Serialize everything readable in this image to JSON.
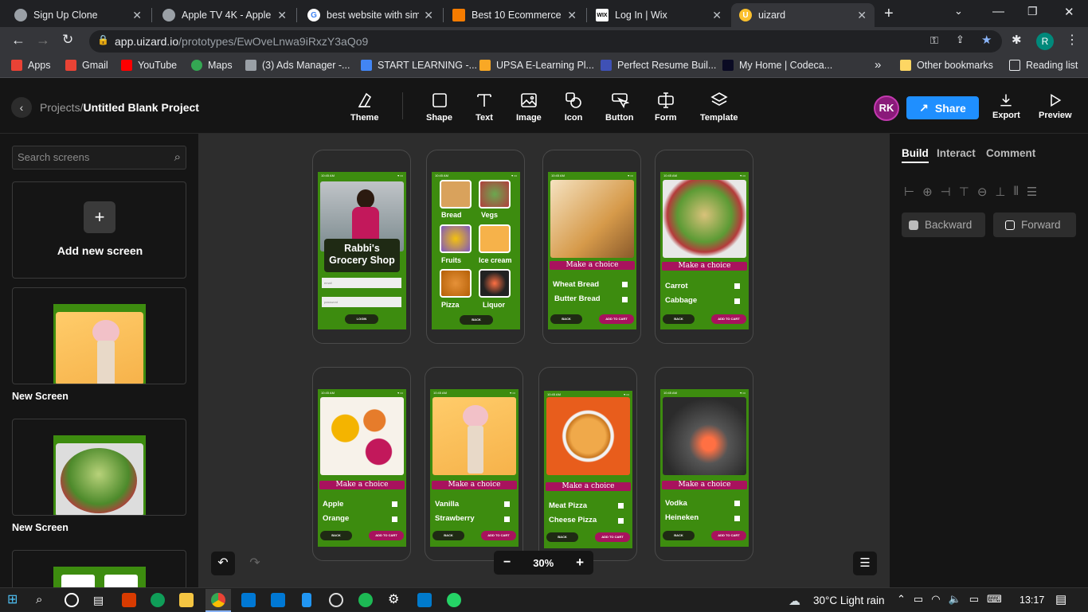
{
  "browser": {
    "tabs": [
      {
        "title": "Sign Up Clone",
        "color": "#9aa0a6"
      },
      {
        "title": "Apple TV 4K - Apple",
        "color": "#9aa0a6"
      },
      {
        "title": "best website with simp",
        "color": "#4285f4"
      },
      {
        "title": "Best 10 Ecommerce S",
        "color": "#f57c00"
      },
      {
        "title": "Log In | Wix",
        "color": "#ffffff"
      },
      {
        "title": "uizard",
        "color": "#fbc02d"
      }
    ],
    "new_tab": "+",
    "url_host": "app.uizard.io",
    "url_path": "/prototypes/EwOveLnwa9iRxzY3aQo9",
    "profile_initial": "R",
    "bookmarks": [
      {
        "label": "Apps",
        "color": "#e94235"
      },
      {
        "label": "Gmail",
        "color": "#ea4335"
      },
      {
        "label": "YouTube",
        "color": "#ff0000"
      },
      {
        "label": "Maps",
        "color": "#34a853"
      },
      {
        "label": "(3) Ads Manager -...",
        "color": "#9aa0a6"
      },
      {
        "label": "START LEARNING -...",
        "color": "#4285f4"
      },
      {
        "label": "UPSA E-Learning Pl...",
        "color": "#f9a825"
      },
      {
        "label": "Perfect Resume Buil...",
        "color": "#3f51b5"
      },
      {
        "label": "My Home | Codeca...",
        "color": "#0a0a23"
      }
    ],
    "more": "»",
    "other_bookmarks": "Other bookmarks",
    "reading_list": "Reading list"
  },
  "app": {
    "breadcrumb_root": "Projects",
    "breadcrumb_sep": "/",
    "project_title": "Untitled Blank Project",
    "tools": [
      {
        "label": "Theme",
        "icon": "theme-icon"
      },
      {
        "label": "Shape",
        "icon": "shape-icon"
      },
      {
        "label": "Text",
        "icon": "text-icon"
      },
      {
        "label": "Image",
        "icon": "image-icon"
      },
      {
        "label": "Icon",
        "icon": "icon-icon"
      },
      {
        "label": "Button",
        "icon": "button-icon"
      },
      {
        "label": "Form",
        "icon": "form-icon"
      },
      {
        "label": "Template",
        "icon": "template-icon"
      }
    ],
    "avatar": "RK",
    "share": "Share",
    "export": "Export",
    "preview": "Preview"
  },
  "left_panel": {
    "search_placeholder": "Search screens",
    "add_screen": "Add new screen",
    "add_plus": "+",
    "screens": [
      {
        "name": "New Screen"
      },
      {
        "name": "New Screen"
      }
    ]
  },
  "right_panel": {
    "tabs": [
      "Build",
      "Interact",
      "Comment"
    ],
    "backward": "Backward",
    "forward": "Forward"
  },
  "canvas": {
    "zoom": "30%",
    "zoom_out": "−",
    "zoom_in": "+",
    "login": {
      "title": "Rabbi's Grocery Shop",
      "email_ph": "email",
      "password_ph": "password",
      "login_btn": "LOGIN"
    },
    "categories": [
      {
        "label": "Bread"
      },
      {
        "label": "Vegs"
      },
      {
        "label": "Fruits"
      },
      {
        "label": "Ice cream"
      },
      {
        "label": "Pizza"
      },
      {
        "label": "Liquor"
      }
    ],
    "back": "BACK",
    "add_to_cart": "ADD TO CART",
    "make_choice": "Make a choice",
    "status_time": "10:45 AM",
    "choice_screens": [
      {
        "options": [
          "Wheat Bread",
          "Butter Bread"
        ]
      },
      {
        "options": [
          "Carrot",
          "Cabbage"
        ]
      },
      {
        "options": [
          "Apple",
          "Orange"
        ]
      },
      {
        "options": [
          "Vanilla",
          "Strawberry"
        ]
      },
      {
        "options": [
          "Meat Pizza",
          "Cheese Pizza"
        ]
      },
      {
        "options": [
          "Vodka",
          "Heineken"
        ]
      }
    ]
  },
  "taskbar": {
    "weather": "30°C  Light rain",
    "time": "13:17"
  }
}
